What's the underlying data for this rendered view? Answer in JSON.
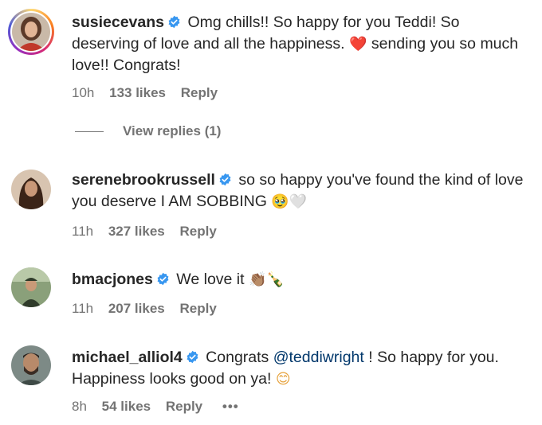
{
  "comments": [
    {
      "username": "susiecevans",
      "text": "Omg chills!! So happy for you Teddi! So deserving of love and all the happiness.",
      "emoji1": "❤️",
      "text2": "sending you so much love!! Congrats!",
      "time": "10h",
      "likes": "133 likes",
      "reply": "Reply"
    },
    {
      "username": "serenebrookrussell",
      "text": "so so happy you've found the kind of love you deserve I AM SOBBING",
      "emoji1": "🥹🤍",
      "time": "11h",
      "likes": "327 likes",
      "reply": "Reply"
    },
    {
      "username": "bmacjones",
      "text": "We love it",
      "emoji1": "👏🏽🍾",
      "time": "11h",
      "likes": "207 likes",
      "reply": "Reply"
    },
    {
      "username": "michael_alliol4",
      "text": "Congrats",
      "mention": "@teddiwright",
      "text2": "! So happy for you. Happiness looks good on ya!",
      "emoji1": "😊",
      "time": "8h",
      "likes": "54 likes",
      "reply": "Reply",
      "more": "•••"
    }
  ],
  "view_replies": "View replies (1)",
  "colors": {
    "verified": "#3897f0",
    "meta": "#737373",
    "mention": "#00376b"
  }
}
